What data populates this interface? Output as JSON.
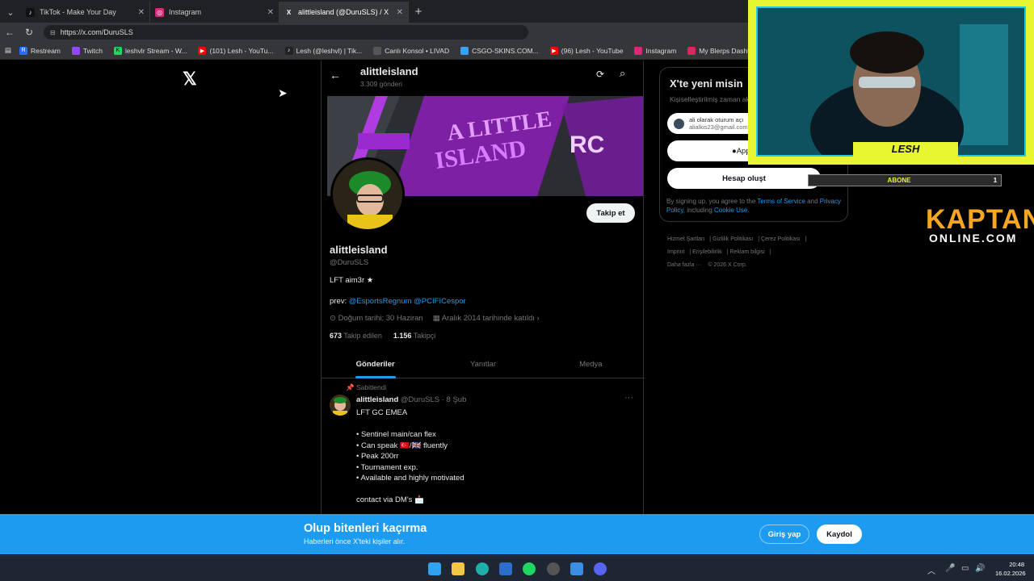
{
  "tabs": [
    {
      "title": "TikTok - Make Your Day",
      "icon": "tiktok-icon"
    },
    {
      "title": "Instagram",
      "icon": "instagram-icon"
    },
    {
      "title": "alittleisland (@DuruSLS) / X",
      "icon": "x-icon"
    }
  ],
  "address": {
    "url": "https://x.com/DuruSLS"
  },
  "bookmarks": [
    {
      "label": "Restream",
      "color": "#2b6bff"
    },
    {
      "label": "Twitch",
      "color": "#9146ff"
    },
    {
      "label": "leshvlr Stream - W...",
      "color": "#1ed760"
    },
    {
      "label": "(101) Lesh - YouTu...",
      "color": "#ff0000"
    },
    {
      "label": "Lesh (@leshvl) | Tik...",
      "color": "#222"
    },
    {
      "label": "Canlı Konsol • LIVAD",
      "color": "#555"
    },
    {
      "label": "CSGO-SKINS.COM...",
      "color": "#3aa0ff"
    },
    {
      "label": "(96) Lesh - YouTube",
      "color": "#ff0000"
    },
    {
      "label": "Instagram",
      "color": "#d62976"
    },
    {
      "label": "My Blerps Dashboa...",
      "color": "#e0245e"
    }
  ],
  "profile": {
    "header_name": "alittleisland",
    "post_count": "3.309 gönderi",
    "follow_label": "Takip et",
    "name": "alittleisland",
    "handle": "@DuruSLS",
    "bio": "LFT aim3r ★",
    "prev_label": "prev: ",
    "prev_links": "@EsportsRegnum @PCIFICespor",
    "birthday": "Doğum tarihi: 30 Haziran",
    "joined": "Aralık 2014 tarihinde katıldı",
    "following_count": "673",
    "following_label": "Takip edilen",
    "followers_count": "1.156",
    "followers_label": "Takipçi"
  },
  "profile_tabs": [
    "Gönderiler",
    "Yanıtlar",
    "Medya"
  ],
  "pinned_tweet": {
    "pinned_label": "Sabitlendi",
    "name": "alittleisland",
    "handle_date": "@DuruSLS · 8 Şub",
    "body": "LFT GC EMEA\n\n• Sentinel main/can flex\n• Can speak 🇹🇷/🇬🇧 fluently\n• Peak 200rr\n• Tournament exp.\n• Available and highly motivated\n\ncontact via DM's 📩"
  },
  "signup_panel": {
    "title": "X'te yeni misin",
    "subtitle": "Kişiselleştirilmiş zaman akı",
    "google_line1": "ali olarak oturum açı",
    "google_line2": "alialkis23@gmail.com",
    "apple_label": "Apple",
    "create_label": "Hesap oluşt",
    "terms_pre": "By signing up, you agree to the ",
    "terms_link": "Terms of Service",
    "terms_and": " and ",
    "privacy_link": "Privacy Policy",
    "terms_mid": ", including ",
    "cookie_link": "Cookie Use",
    "terms_end": "."
  },
  "footer_links": [
    "Hizmet Şartları",
    "Gizlilik Politikası",
    "Çerez Politikası",
    "Imprint",
    "Erişilebilirlik",
    "Reklam bilgisi",
    "Daha fazla ···",
    "© 2026 X Corp."
  ],
  "bottom_banner": {
    "title": "Olup bitenleri kaçırma",
    "subtitle": "Haberleri önce X'teki kişiler alır.",
    "login": "Giriş yap",
    "signup": "Kaydol"
  },
  "overlay": {
    "streamer": "LESH",
    "sub_label": "ABONE",
    "sub_count": "1",
    "brand_top": "KAPTAN",
    "brand_bottom": "ONLINE.COM"
  },
  "taskbar": {
    "time": "20:48",
    "date": "16.02.2026"
  },
  "colors": {
    "accent": "#1d9bf0",
    "overlay_yellow": "#e8f531"
  }
}
